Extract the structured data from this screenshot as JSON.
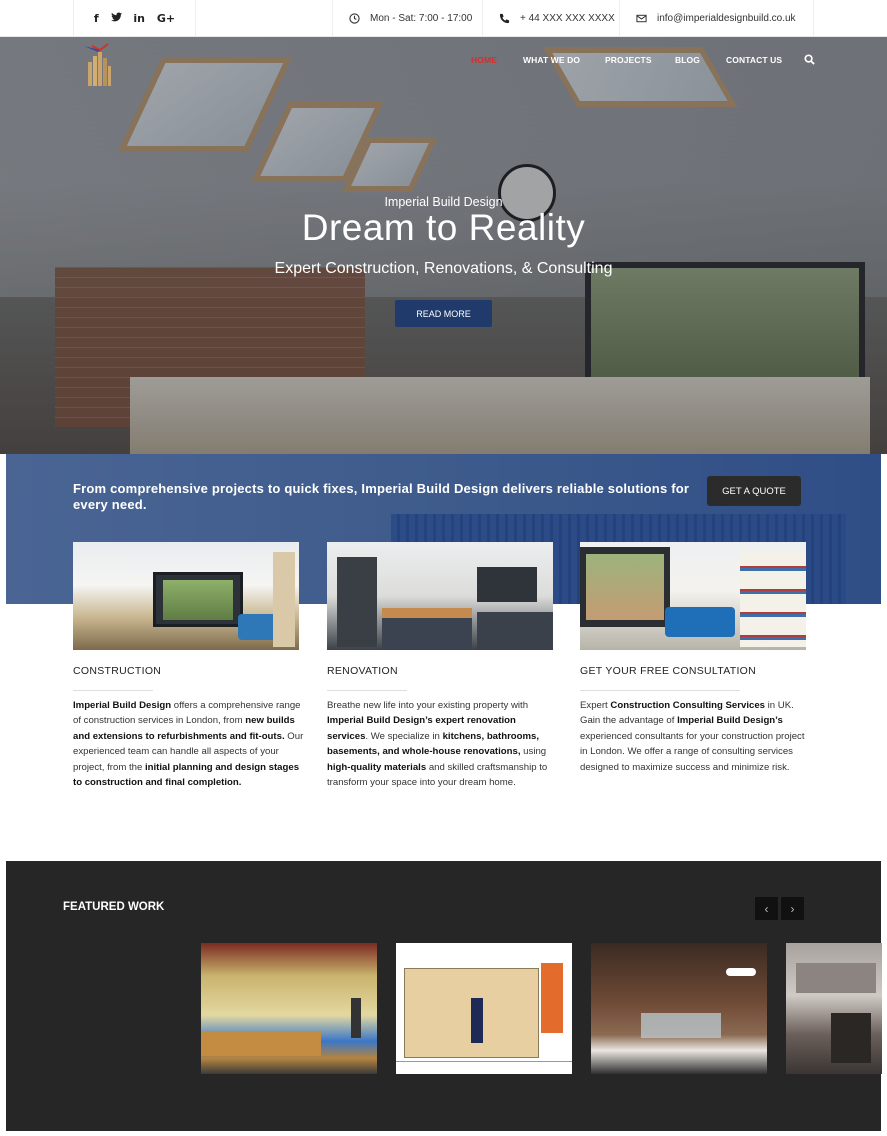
{
  "topbar": {
    "social": [
      "f",
      "t",
      "in",
      "G+"
    ],
    "hours": "Mon - Sat: 7:00 - 17:00",
    "phone": "+ 44 XXX XXX XXXX",
    "email": "info@imperialdesignbuild.co.uk"
  },
  "nav": {
    "items": [
      "HOME",
      "WHAT WE DO",
      "PROJECTS",
      "BLOG",
      "CONTACT US"
    ],
    "active_color": "#d0312d"
  },
  "hero": {
    "kicker": "Imperial Build Design",
    "title": "Dream to Reality",
    "subtitle": "Expert Construction, Renovations, & Consulting",
    "button": "READ MORE"
  },
  "band": {
    "text": "From comprehensive projects to quick fixes, Imperial Build Design delivers reliable solutions for every need.",
    "button": "GET A QUOTE"
  },
  "services": [
    {
      "title": "CONSTRUCTION",
      "body": [
        {
          "b": "Imperial Build Design"
        },
        {
          "t": " offers a comprehensive range of construction services in London, from "
        },
        {
          "b": "new builds and extensions to refurbishments and fit-outs."
        },
        {
          "t": " Our experienced team can handle all aspects of your project, from the "
        },
        {
          "b": "initial planning and design stages to construction and final completion."
        }
      ]
    },
    {
      "title": "RENOVATION",
      "body": [
        {
          "t": "Breathe new life into your existing property with "
        },
        {
          "b": "Imperial Build Design’s expert renovation services"
        },
        {
          "t": ". We specialize in "
        },
        {
          "b": "kitchens, bathrooms, basements, and whole-house renovations,"
        },
        {
          "t": " using "
        },
        {
          "b": "high-quality materials"
        },
        {
          "t": " and skilled craftsmanship to transform your space into your dream home."
        }
      ]
    },
    {
      "title": "GET YOUR FREE CONSULTATION",
      "body": [
        {
          "t": "Expert "
        },
        {
          "b": "Construction Consulting Services"
        },
        {
          "t": " in UK. Gain the advantage of "
        },
        {
          "b": "Imperial Build Design’s"
        },
        {
          "t": " experienced consultants for your construction project in London. We offer a range of consulting services designed to maximize success and minimize risk."
        }
      ]
    }
  ],
  "featured": {
    "title": "FEATURED WORK",
    "prev": "‹",
    "next": "›"
  },
  "colors": {
    "brand_blue": "#1f3a6b",
    "band_blue": "#3e5b8c",
    "dark": "#262626"
  }
}
